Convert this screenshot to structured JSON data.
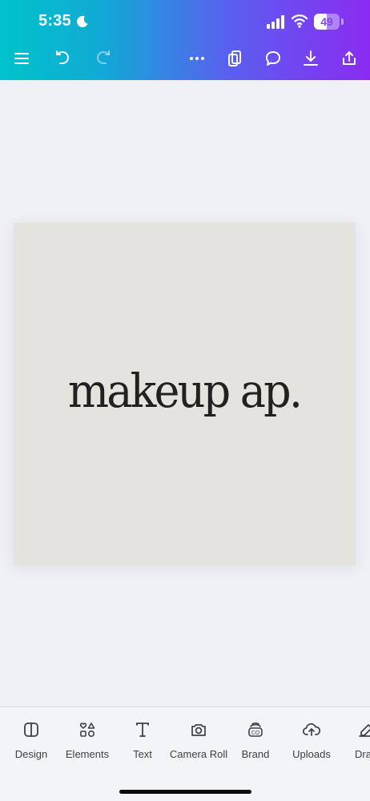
{
  "status_bar": {
    "time": "5:35",
    "battery_level": "49",
    "icons": [
      "moon-icon",
      "signal-bars-icon",
      "wifi-icon",
      "battery-icon"
    ]
  },
  "toolbar": {
    "icons": [
      "menu-icon",
      "undo-icon",
      "redo-icon",
      "more-icon",
      "pages-icon",
      "comment-icon",
      "download-icon",
      "share-icon"
    ]
  },
  "design": {
    "text": "makeup ap."
  },
  "bottom_nav": {
    "items": [
      {
        "label": "Design",
        "icon": "design-icon"
      },
      {
        "label": "Elements",
        "icon": "elements-icon"
      },
      {
        "label": "Text",
        "icon": "text-icon"
      },
      {
        "label": "Camera Roll",
        "icon": "camera-icon"
      },
      {
        "label": "Brand",
        "icon": "brand-icon"
      },
      {
        "label": "Uploads",
        "icon": "upload-cloud-icon"
      },
      {
        "label": "Dra",
        "icon": "draw-icon"
      }
    ]
  },
  "colors": {
    "canvas_background": "#eff0f5",
    "design_background": "#e4e3de",
    "text_color": "#222020",
    "toolbar_gradient_start": "#00c3c9",
    "toolbar_gradient_end": "#8b2bf0"
  }
}
